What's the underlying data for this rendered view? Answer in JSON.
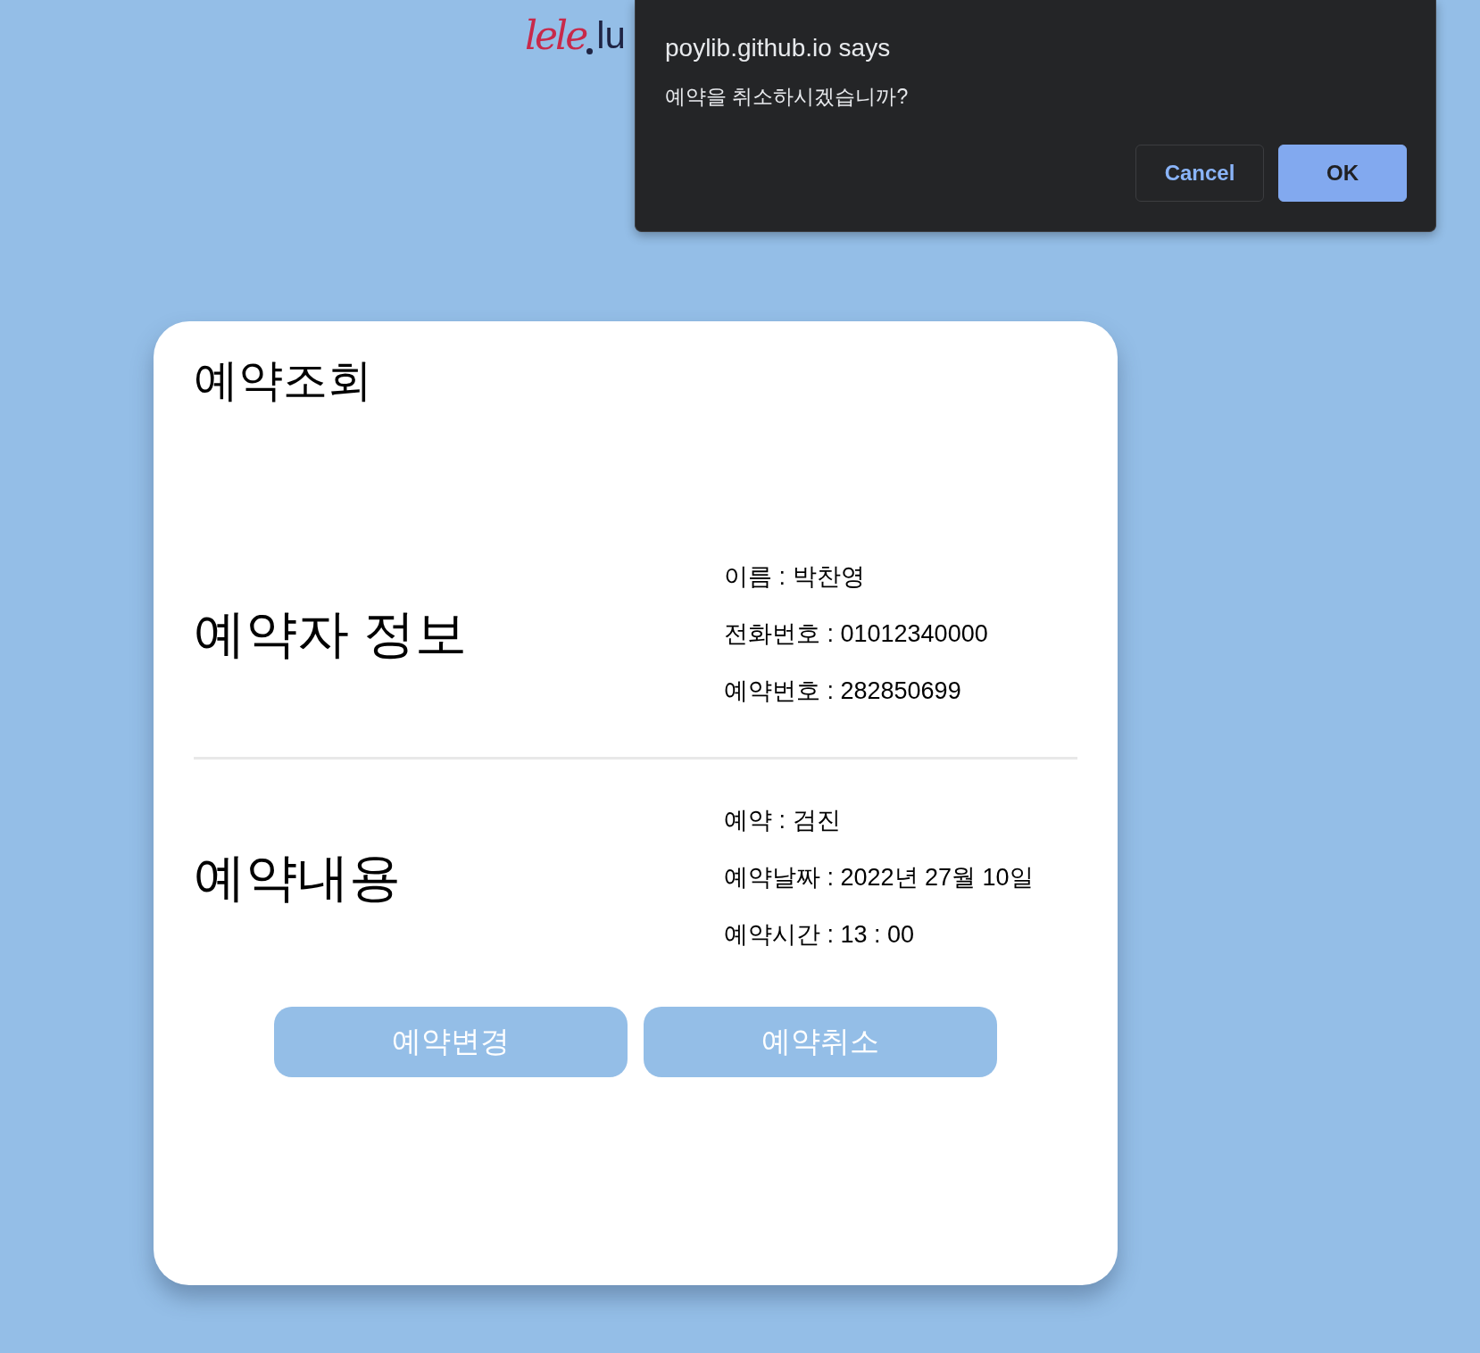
{
  "logo": {
    "script": "lele",
    "text": "lu"
  },
  "dialog": {
    "title": "poylib.github.io says",
    "message": "예약을 취소하시겠습니까?",
    "buttons": [
      {
        "label": "Cancel",
        "kind": "secondary"
      },
      {
        "label": "OK",
        "kind": "primary"
      }
    ]
  },
  "card": {
    "title": "예약조회",
    "sections": [
      {
        "heading": "예약자 정보",
        "rows": [
          "이름 : 박찬영",
          "전화번호 : 01012340000",
          "예약번호 : 282850699"
        ]
      },
      {
        "heading": "예약내용",
        "rows": [
          "예약 : 검진",
          "예약날짜 : 2022년 27월 10일",
          "예약시간 : 13 : 00"
        ]
      }
    ],
    "buttons": [
      "예약변경",
      "예약취소"
    ]
  }
}
